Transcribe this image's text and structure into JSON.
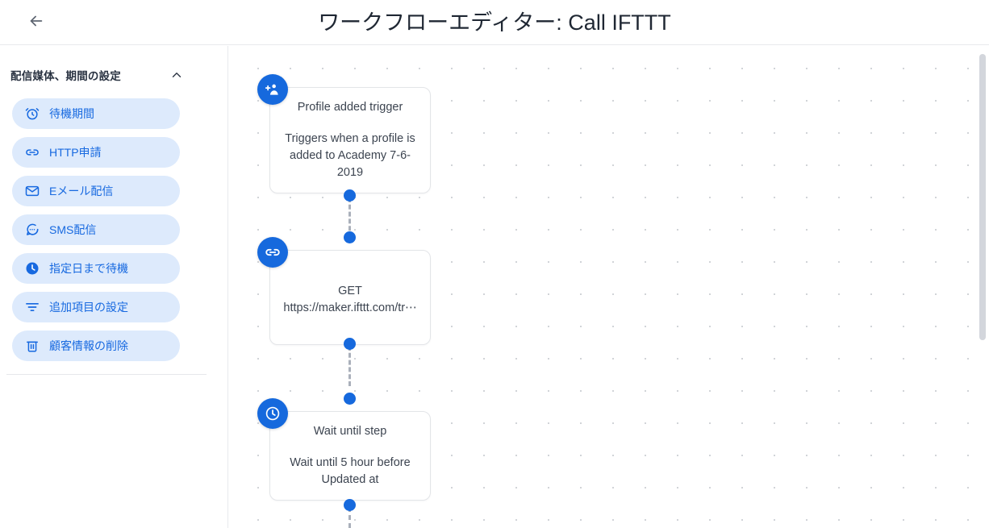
{
  "header": {
    "back_icon": "arrow-left-icon",
    "title": "ワークフローエディター: Call IFTTT"
  },
  "sidebar": {
    "section_title": "配信媒体、期間の設定",
    "collapse_icon": "chevron-up-icon",
    "items": [
      {
        "label": "待機期間",
        "icon": "alarm-clock-icon"
      },
      {
        "label": "HTTP申請",
        "icon": "link-icon"
      },
      {
        "label": "Eメール配信",
        "icon": "envelope-icon"
      },
      {
        "label": "SMS配信",
        "icon": "chat-bubble-icon"
      },
      {
        "label": "指定日まで待機",
        "icon": "clock-filled-icon"
      },
      {
        "label": "追加項目の設定",
        "icon": "filter-icon"
      },
      {
        "label": "顧客情報の削除",
        "icon": "trash-icon"
      }
    ]
  },
  "canvas": {
    "nodes": [
      {
        "icon": "person-add-icon",
        "title": "Profile added trigger",
        "description": "Triggers when a profile is added to Academy 7-6-2019"
      },
      {
        "icon": "link-icon",
        "title": "GET",
        "description": "https://maker.ifttt.com/tr⋯"
      },
      {
        "icon": "clock-filled-icon",
        "title": "Wait until step",
        "description": "Wait until 5 hour before Updated at"
      }
    ]
  },
  "colors": {
    "accent": "#1669dd",
    "pill_background": "#ddeafc",
    "pill_text": "#1769e0",
    "node_text": "#3c4450",
    "title_text": "#1f2733",
    "connector": "#aab0bb",
    "grid_dot": "#c9ccd1"
  },
  "scrollbar": {
    "orientation": "vertical"
  }
}
